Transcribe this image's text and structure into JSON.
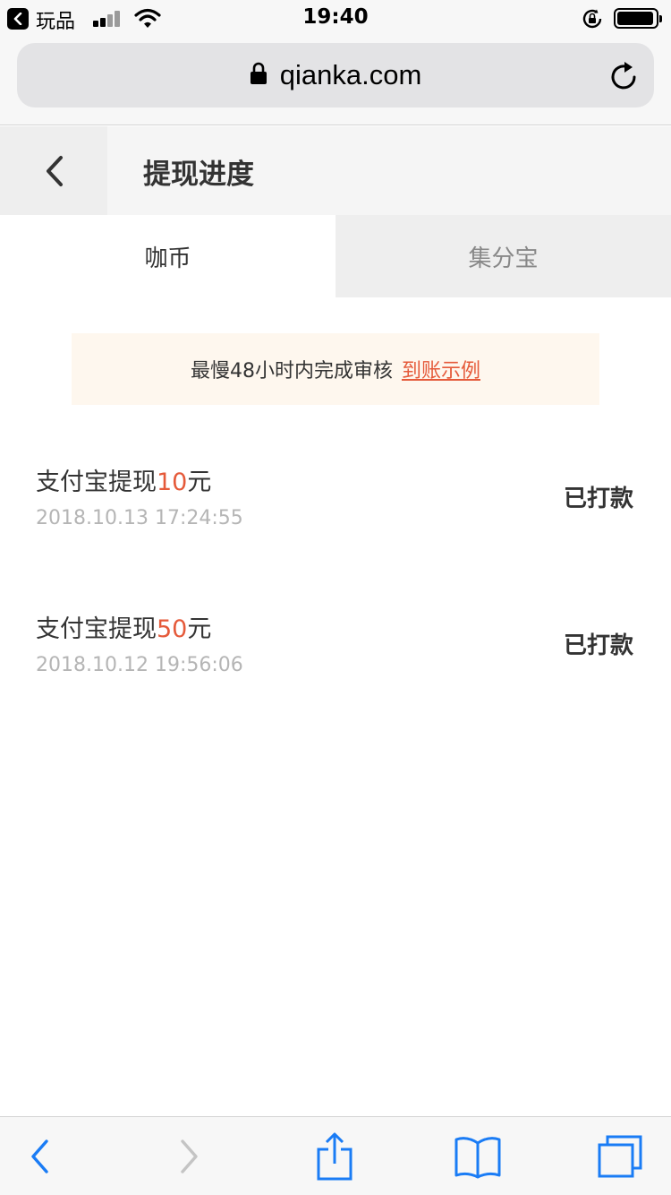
{
  "status_bar": {
    "back_app_label": "玩品",
    "time": "19:40",
    "icons": [
      "back-arrow-icon",
      "signal-icon",
      "wifi-icon",
      "orientation-lock-icon",
      "battery-icon"
    ]
  },
  "browser": {
    "url": "qianka.com",
    "icons": [
      "lock-icon",
      "reload-icon"
    ]
  },
  "header": {
    "title": "提现进度",
    "back_icon": "chevron-left-icon"
  },
  "tabs": [
    {
      "label": "咖币",
      "active": true
    },
    {
      "label": "集分宝",
      "active": false
    }
  ],
  "notice": {
    "text": "最慢48小时内完成审核",
    "link_label": "到账示例",
    "link_color": "#e55a3a",
    "background": "#fef7ee"
  },
  "records": [
    {
      "title_prefix": "支付宝提现",
      "amount": "10",
      "unit": "元",
      "time": "2018.10.13 17:24:55",
      "status": "已打款"
    },
    {
      "title_prefix": "支付宝提现",
      "amount": "50",
      "unit": "元",
      "time": "2018.10.12 19:56:06",
      "status": "已打款"
    }
  ],
  "toolbar": {
    "icons": [
      "back-icon",
      "forward-icon",
      "share-icon",
      "bookmarks-icon",
      "tabs-icon"
    ],
    "accent": "#1a7cf5"
  }
}
